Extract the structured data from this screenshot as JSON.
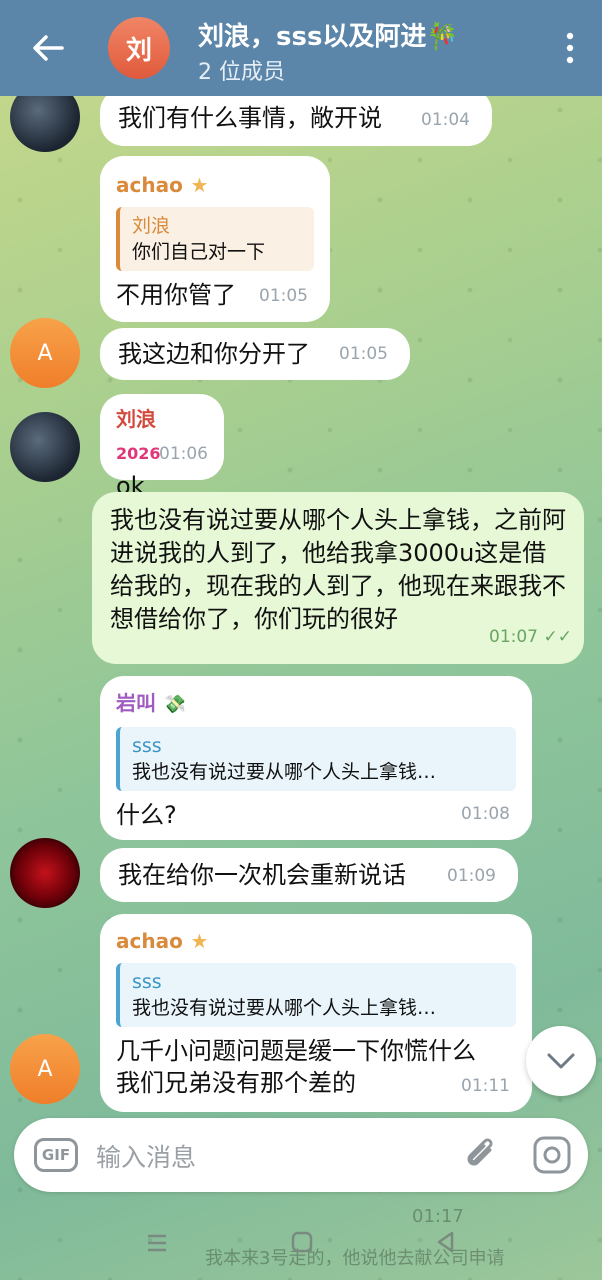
{
  "header": {
    "avatar_letter": "刘",
    "title": "刘浪，sss以及阿进🎋",
    "subtitle": "2 位成员"
  },
  "messages": [
    {
      "text": "我们有什么事情，敞开说",
      "time": "01:04"
    },
    {
      "sender": "achao",
      "sender_badge": "★",
      "reply_name": "刘浪",
      "reply_text": "你们自己对一下",
      "text": "不用你管了",
      "time": "01:05"
    },
    {
      "avatar": "A",
      "text": "我这边和你分开了",
      "time": "01:05"
    },
    {
      "sender": "刘浪",
      "sender_badge": "2026",
      "text": "ok",
      "time": "01:06"
    },
    {
      "text": "我也没有说过要从哪个人头上拿钱，之前阿进说我的人到了，他给我拿3000u这是借给我的，现在我的人到了，他现在来跟我不想借给你了，你们玩的很好",
      "time": "01:07",
      "status": "✓✓"
    },
    {
      "sender": "岩叫",
      "reply_name": "sss",
      "reply_text": "我也没有说过要从哪个人头上拿钱…",
      "text": "什么?",
      "time": "01:08"
    },
    {
      "text": "我在给你一次机会重新说话",
      "time": "01:09"
    },
    {
      "sender": "achao",
      "sender_badge": "★",
      "avatar": "A",
      "reply_name": "sss",
      "reply_text": "我也没有说过要从哪个人头上拿钱…",
      "text": "几千小问题问题是缓一下你慌什么我们兄弟没有那个差的",
      "time": "01:11"
    }
  ],
  "behind": {
    "time": "01:17",
    "text": "我本来3号走的，他说他去献公司申请"
  },
  "input": {
    "gif_label": "GIF",
    "placeholder": "输入消息"
  },
  "colors": {
    "header": "#5b86aa",
    "outgoing": "#e6f8d6",
    "name_orange": "#d98a3b",
    "name_purple": "#a05bc0",
    "name_red": "#d2493e"
  }
}
